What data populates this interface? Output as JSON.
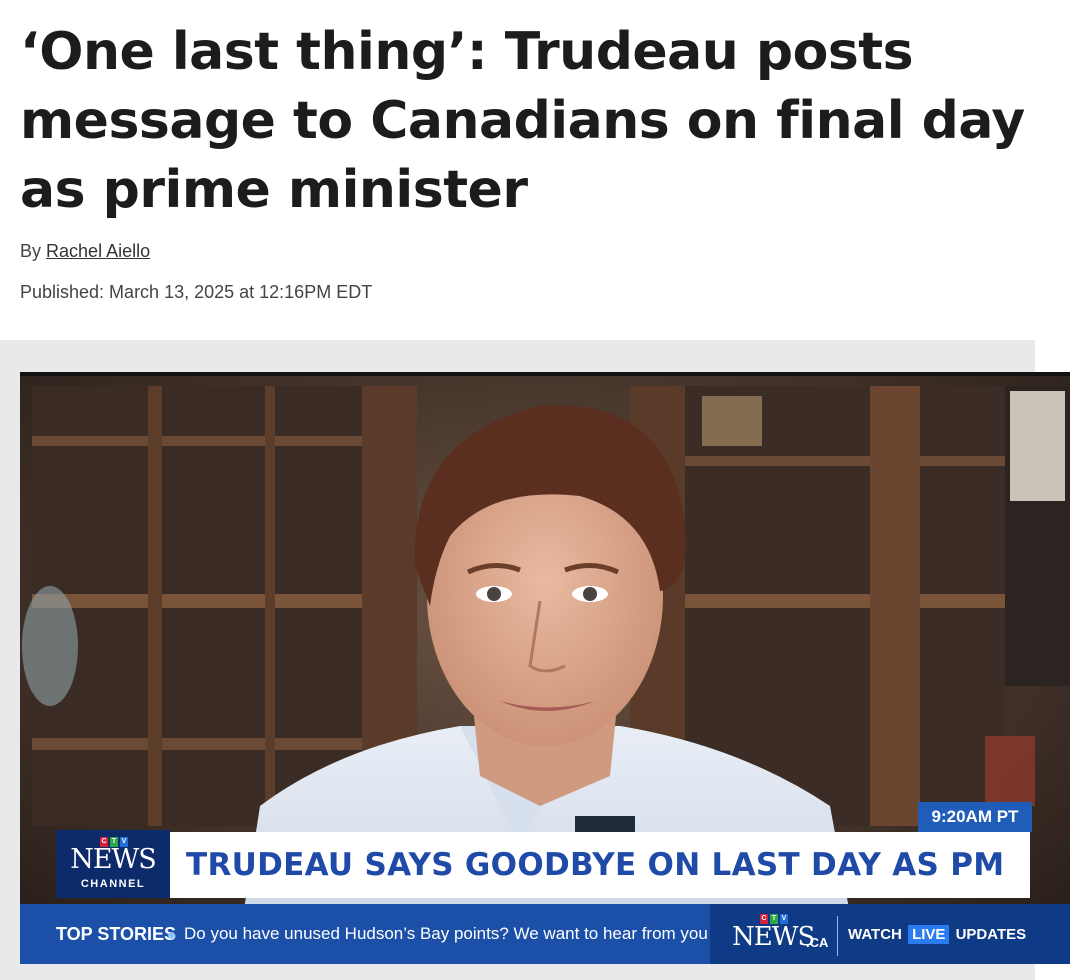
{
  "article": {
    "headline": "‘One last thing’: Trudeau posts message to Canadians on final day as prime minister",
    "by_prefix": "By",
    "author": "Rachel Aiello",
    "published": "Published: March 13, 2025 at 12:16PM EDT"
  },
  "video": {
    "clock": "9:20AM PT",
    "logo": {
      "ctv_letters": [
        "C",
        "T",
        "V"
      ],
      "ctv_colors": [
        "#d4213d",
        "#2aa84a",
        "#1f6fd6"
      ],
      "news": "NEWS",
      "channel": "CHANNEL"
    },
    "lower_third": "TRUDEAU SAYS GOODBYE ON LAST DAY AS PM",
    "ticker": {
      "title": "TOP STORIES",
      "text": "Do you have unused Hudson’s Bay points? We want to hear from you",
      "brand_news": "NEWS",
      "brand_ca": ".CA",
      "watch": "WATCH",
      "live": "LIVE",
      "updates": "UPDATES"
    }
  }
}
